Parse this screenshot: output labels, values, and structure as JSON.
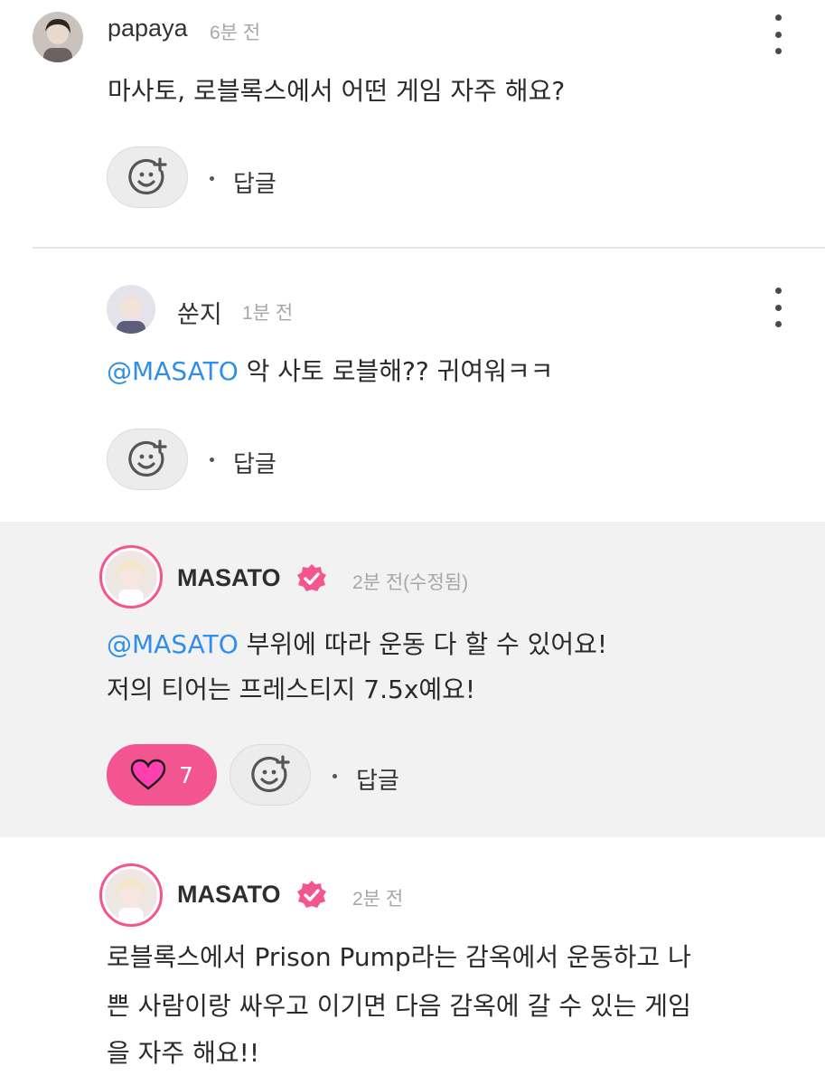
{
  "comments": [
    {
      "author": "papaya",
      "time": "6분 전",
      "text": "마사토, 로블록스에서 어떤 게임 자주 해요?",
      "reply_label": "답글"
    },
    {
      "author": "쑨지",
      "time": "1분 전",
      "mention": "@MASATO",
      "text": " 악 사토 로블해?? 귀여워ㅋㅋ",
      "reply_label": "답글"
    },
    {
      "author": "MASATO",
      "time": "2분 전(수정됨)",
      "mention": "@MASATO",
      "text_line1": " 부위에 따라 운동 다 할 수 있어요!",
      "text_line2": "저의 티어는 프레스티지 7.5x예요!",
      "like_count": "7",
      "reply_label": "답글",
      "verified": true
    },
    {
      "author": "MASATO",
      "time": "2분 전",
      "text_line1": "로블록스에서 Prison Pump라는 감옥에서 운동하고 나",
      "text_line2": "쁜 사람이랑 싸우고 이기면 다음 감옥에 갈 수 있는 게임",
      "text_line3": "을 자주 해요!!",
      "verified": true
    }
  ],
  "icons": {
    "more": "more-vertical-icon",
    "reaction": "add-reaction-icon",
    "like": "heart-icon",
    "verified": "verified-badge-icon"
  },
  "colors": {
    "accent_pink": "#f2558f",
    "mention_blue": "#2f8fe8",
    "highlight_bg": "#f2f2f2"
  }
}
